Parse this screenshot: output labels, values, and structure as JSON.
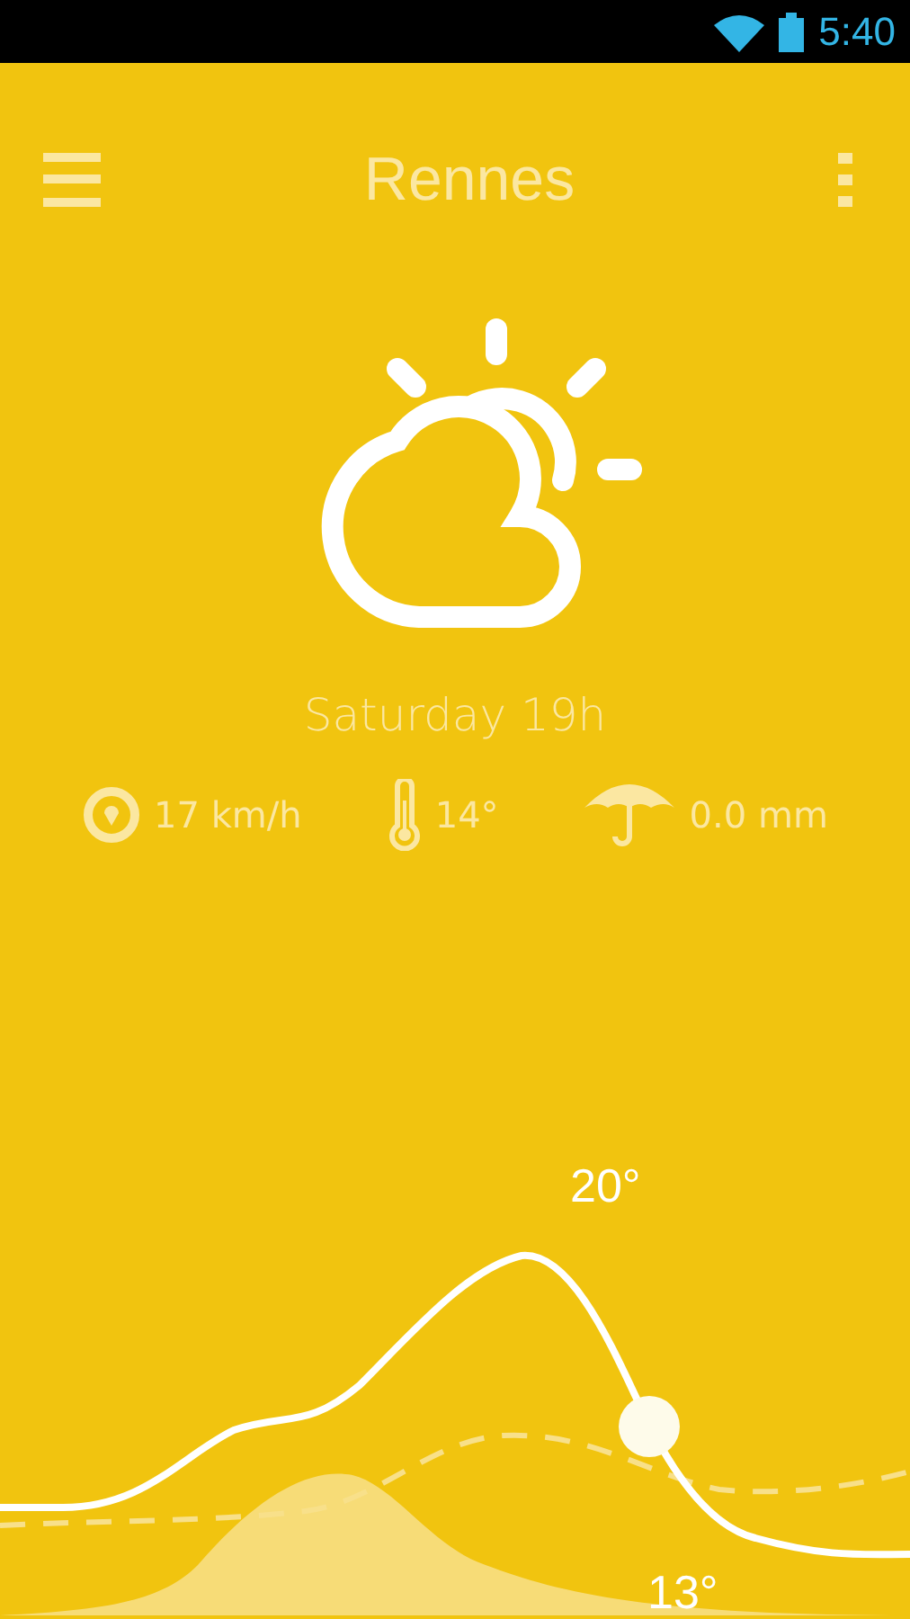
{
  "status_bar": {
    "time": "5:40"
  },
  "header": {
    "title": "Rennes"
  },
  "forecast": {
    "time_label": "Saturday 19h"
  },
  "stats": [
    {
      "kind": "wind",
      "value": "17 km/h"
    },
    {
      "kind": "temperature",
      "value": "14°"
    },
    {
      "kind": "rain",
      "value": "0.0 mm"
    }
  ],
  "chart": {
    "max_label": "20°",
    "min_label": "13°"
  }
}
